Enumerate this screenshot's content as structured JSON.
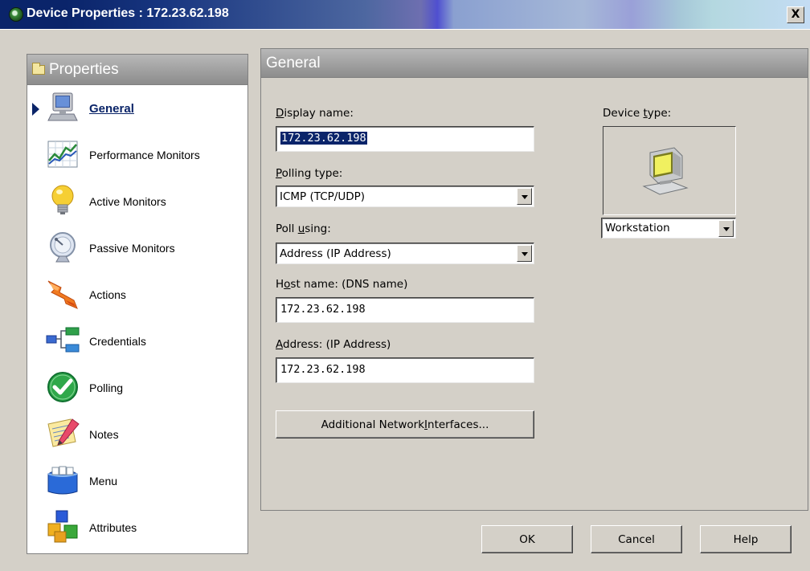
{
  "window": {
    "title": "Device Properties : 172.23.62.198",
    "close_label": "X"
  },
  "left_panel": {
    "header": "Properties",
    "items": [
      {
        "label": "General",
        "icon": "computer-icon",
        "active": true
      },
      {
        "label": "Performance Monitors",
        "icon": "chart-icon"
      },
      {
        "label": "Active Monitors",
        "icon": "lightbulb-icon"
      },
      {
        "label": "Passive Monitors",
        "icon": "satellite-dish-icon"
      },
      {
        "label": "Actions",
        "icon": "lightning-icon"
      },
      {
        "label": "Credentials",
        "icon": "network-tree-icon"
      },
      {
        "label": "Polling",
        "icon": "checkmark-icon"
      },
      {
        "label": "Notes",
        "icon": "notepad-icon"
      },
      {
        "label": "Menu",
        "icon": "menu-box-icon"
      },
      {
        "label": "Attributes",
        "icon": "cubes-icon"
      }
    ]
  },
  "general": {
    "header": "General",
    "display_name_label_u": "D",
    "display_name_label_rest": "isplay name:",
    "display_name_value": "172.23.62.198",
    "polling_type_label_u": "P",
    "polling_type_label_rest": "olling type:",
    "polling_type_value": "ICMP  (TCP/UDP)",
    "poll_using_label_pre": "Poll ",
    "poll_using_label_u": "u",
    "poll_using_label_rest": "sing:",
    "poll_using_value": "Address  (IP Address)",
    "host_name_label_pre": "H",
    "host_name_label_u": "o",
    "host_name_label_rest": "st name: (DNS name)",
    "host_name_value": "172.23.62.198",
    "address_label_u": "A",
    "address_label_rest": "ddress: (IP Address)",
    "address_value": "172.23.62.198",
    "additional_pre": "Additional Network ",
    "additional_u": "I",
    "additional_rest": "nterfaces...",
    "device_type_label_pre": "Device ",
    "device_type_label_u": "t",
    "device_type_label_rest": "ype:",
    "device_type_value": "Workstation",
    "device_icon": "workstation-icon"
  },
  "buttons": {
    "ok": "OK",
    "cancel": "Cancel",
    "help": "Help"
  },
  "colors": {
    "title_bar": "#0a246a",
    "selection": "#0a246a",
    "panel_header": "#9c9c9c"
  }
}
